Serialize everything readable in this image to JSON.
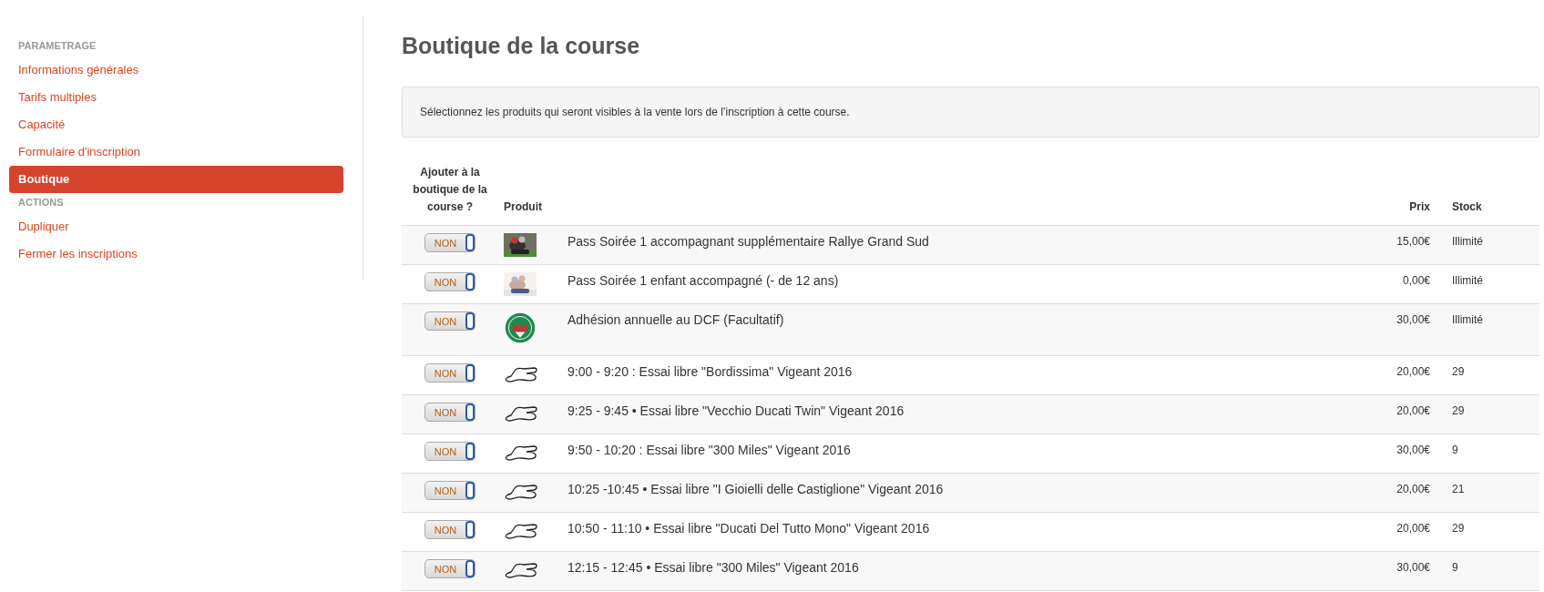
{
  "sidebar": {
    "sections": [
      {
        "title": "PARAMETRAGE",
        "items": [
          {
            "label": "Informations générales",
            "selected": false
          },
          {
            "label": "Tarifs multiples",
            "selected": false
          },
          {
            "label": "Capacité",
            "selected": false
          },
          {
            "label": "Formulaire d'inscription",
            "selected": false
          },
          {
            "label": "Boutique",
            "selected": true
          }
        ]
      },
      {
        "title": "ACTIONS",
        "items": [
          {
            "label": "Dupliquer",
            "selected": false
          },
          {
            "label": "Fermer les inscriptions",
            "selected": false
          }
        ]
      }
    ]
  },
  "page": {
    "title": "Boutique de la course",
    "notice": "Sélectionnez les produits qui seront visibles à la vente lors de l’inscription à cette course."
  },
  "table": {
    "columns": [
      "Ajouter à la boutique de la course ?",
      "Produit",
      "Prix",
      "Stock"
    ],
    "rows": [
      {
        "toggle": {
          "label": "NON",
          "on": false
        },
        "name": "Pass Soirée 1 accompagnant supplémentaire Rallye Grand Sud",
        "price": "15,00€",
        "stock": "Illimité"
      },
      {
        "toggle": {
          "label": "NON",
          "on": false
        },
        "name": "Pass Soirée 1 enfant accompagné (- de 12 ans)",
        "price": "0,00€",
        "stock": "Illimité"
      },
      {
        "toggle": {
          "label": "NON",
          "on": false
        },
        "kind": "logo",
        "name": "Adhésion annuelle au DCF (Facultatif)",
        "price": "30,00€",
        "stock": "Illimité"
      },
      {
        "toggle": {
          "label": "NON",
          "on": false
        },
        "kind": "track",
        "name": "9:00 - 9:20 : Essai libre \"Bordissima\" Vigeant 2016",
        "price": "20,00€",
        "stock": "29"
      },
      {
        "toggle": {
          "label": "NON",
          "on": false
        },
        "kind": "track",
        "name": "9:25 - 9:45 • Essai libre \"Vecchio Ducati Twin\" Vigeant 2016",
        "price": "20,00€",
        "stock": "29"
      },
      {
        "toggle": {
          "label": "NON",
          "on": false
        },
        "kind": "track",
        "name": "9:50 - 10:20 : Essai libre \"300 Miles\" Vigeant 2016",
        "price": "30,00€",
        "stock": "9"
      },
      {
        "toggle": {
          "label": "NON",
          "on": false
        },
        "kind": "track",
        "name": "10:25 -10:45 • Essai libre \"I Gioielli delle Castiglione\" Vigeant 2016",
        "price": "20,00€",
        "stock": "21"
      },
      {
        "toggle": {
          "label": "NON",
          "on": false
        },
        "kind": "track",
        "name": "10:50 - 11:10 • Essai libre \"Ducati Del Tutto Mono\" Vigeant 2016",
        "price": "20,00€",
        "stock": "29"
      },
      {
        "toggle": {
          "label": "NON",
          "on": false
        },
        "kind": "track",
        "name": "12:15 - 12:45 • Essai libre \"300 Miles\" Vigeant 2016",
        "price": "30,00€",
        "stock": "9"
      }
    ]
  }
}
